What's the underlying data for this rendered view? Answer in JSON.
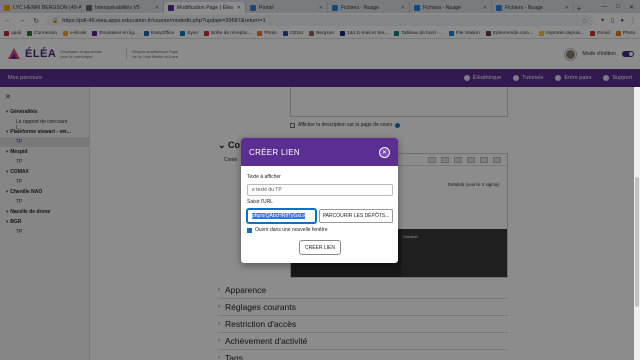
{
  "browser": {
    "tabs": [
      {
        "label": "LYC HENRI BERGSON (49-A",
        "color": "#f4a300",
        "active": false
      },
      {
        "label": "Interopérabilités V5",
        "color": "#6d6d6d",
        "active": false
      },
      {
        "label": "Modification Page | Éléa",
        "color": "#5b2e91",
        "active": true
      },
      {
        "label": "Portail",
        "color": "#3b7dd8",
        "active": false
      },
      {
        "label": "Fichiers - Nuage",
        "color": "#1e88e5",
        "active": false
      },
      {
        "label": "Fichiers - Nuage",
        "color": "#1e88e5",
        "active": false
      },
      {
        "label": "Fichiers - Nuage",
        "color": "#1e88e5",
        "active": false
      }
    ],
    "url": "https://pdl-49.elea.apps.education.fr/course/modedit.php?update=39587&return=1",
    "bookmarks": [
      {
        "label": "upoli",
        "color": "#c62828"
      },
      {
        "label": "Connexion",
        "color": "#2e7d32"
      },
      {
        "label": "e-lilcole",
        "color": "#f9a825"
      },
      {
        "label": "Émulateur en lig...",
        "color": "#6a1b9a"
      },
      {
        "label": "EasyOffice",
        "color": "#1565c0"
      },
      {
        "label": "Syno",
        "color": "#0277bd"
      },
      {
        "label": "Boîte de réceptio...",
        "color": "#d32f2f"
      },
      {
        "label": "Photo",
        "color": "#f57c00"
      },
      {
        "label": "CESU",
        "color": "#3949ab"
      },
      {
        "label": "Bergson",
        "color": "#8d6e63"
      },
      {
        "label": "1&1 E-mail et Sm...",
        "color": "#1a237e"
      },
      {
        "label": "Tableau de bord -...",
        "color": "#00897b"
      },
      {
        "label": "File Station",
        "color": "#0288d1"
      },
      {
        "label": "Ephemeride.com...",
        "color": "#5d4037"
      },
      {
        "label": "Importés depuis...",
        "color": "#fbc02d"
      },
      {
        "label": "Gmail",
        "color": "#d93025"
      },
      {
        "label": "Photo",
        "color": "#f57c00"
      }
    ],
    "bookmarks_more": "»",
    "other_bookmarks": "Autres favoris"
  },
  "header": {
    "logo_text": "ÉLÉA",
    "tagline": "Enseigner et apprendre pour le numérique",
    "region": "Région académique Pays de la Loire Maine-et-Loire",
    "edit_mode_label": "Mode d'édition"
  },
  "nav": {
    "left_label": "Mes parcours",
    "links": [
      "Éléathèque",
      "Tutoriels",
      "Entre pairs",
      "Support"
    ]
  },
  "sidebar": {
    "close_label": "✕",
    "sections": [
      {
        "title": "Généralités",
        "items": [
          "Le rapport de concours l..."
        ]
      },
      {
        "title": "Plateforme stewart - vér...",
        "items": [
          "TP"
        ]
      },
      {
        "title": "Mespid",
        "items": [
          "TP"
        ]
      },
      {
        "title": "COMAX",
        "items": [
          "TP"
        ]
      },
      {
        "title": "Chenille NAO",
        "items": [
          "TP"
        ]
      },
      {
        "title": "Nacelle de drone",
        "items": []
      },
      {
        "title": "BGR",
        "items": [
          "TP"
        ]
      }
    ],
    "active_index": 1
  },
  "main": {
    "show_description_label": "Afficher la description sur la page de cours",
    "content_heading": "Co",
    "content_label": "Conte",
    "editor_text": "Détailab (source 3 sigma)",
    "editor_caption": "Détailab",
    "accordions": [
      "Apparence",
      "Réglages courants",
      "Restriction d'accès",
      "Achèvement d'activité",
      "Tags"
    ]
  },
  "modal": {
    "title": "CRÉER LIEN",
    "close_label": "✕",
    "text_label": "Texte à afficher",
    "text_value": "e texte du TP",
    "url_label": "Saisir l'URL",
    "url_value": "php/s/QAbcHRtfTyGxLv",
    "browse_label": "PARCOURIR LES DÉPÔTS...",
    "new_window_label": "Ouvrir dans une nouvelle fenêtre",
    "new_window_checked": true,
    "create_label": "CRÉER LIEN"
  }
}
